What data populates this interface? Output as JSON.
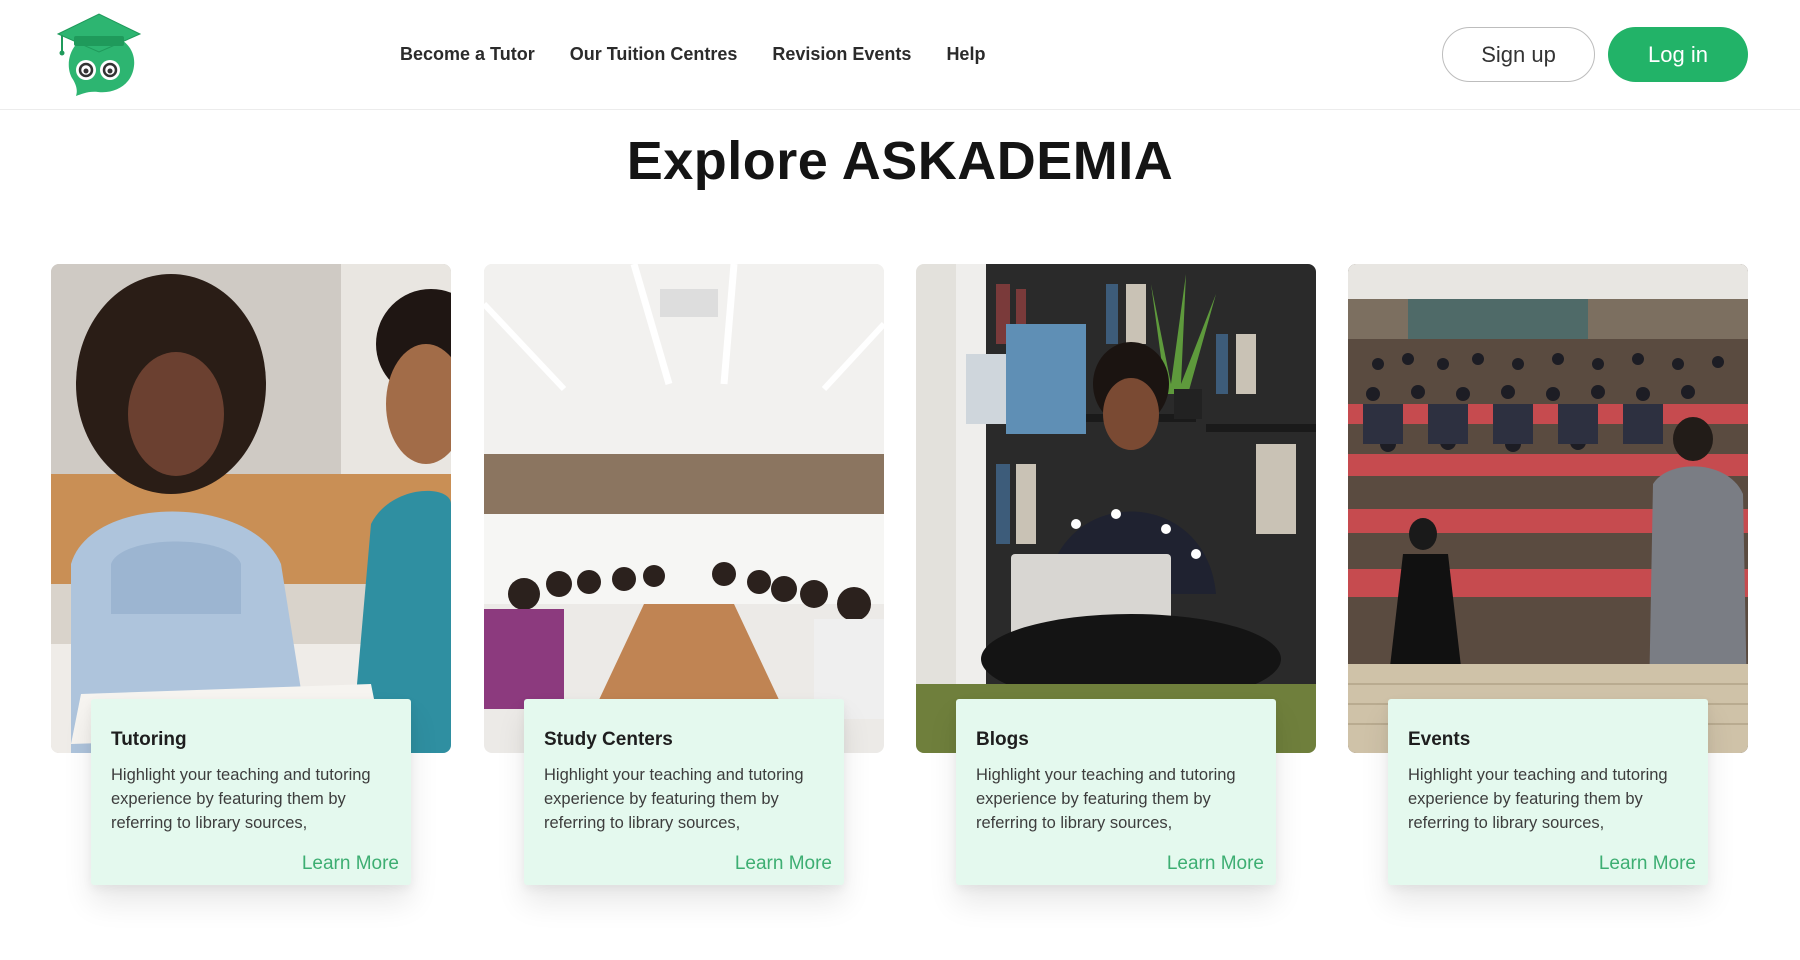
{
  "header": {
    "nav": [
      {
        "label": "Become a Tutor"
      },
      {
        "label": "Our Tuition Centres"
      },
      {
        "label": "Revision Events"
      },
      {
        "label": "Help"
      }
    ],
    "signup_label": "Sign up",
    "login_label": "Log in"
  },
  "main": {
    "title": "Explore ASKADEMIA",
    "cards": [
      {
        "title": "Tutoring",
        "description": "Highlight your teaching and tutoring experience by featuring them by referring to library sources,",
        "link": "Learn More",
        "image": "photo-tutoring"
      },
      {
        "title": "Study Centers",
        "description": "Highlight your teaching and tutoring experience by featuring them by referring to library sources,",
        "link": "Learn More",
        "image": "photo-study-center-meeting"
      },
      {
        "title": "Blogs",
        "description": "Highlight your teaching and tutoring experience by featuring them by referring to library sources,",
        "link": "Learn More",
        "image": "photo-woman-with-laptop"
      },
      {
        "title": "Events",
        "description": "Highlight your teaching and tutoring experience by featuring them by referring to library sources,",
        "link": "Learn More",
        "image": "photo-lecture-hall"
      }
    ]
  },
  "colors": {
    "brand_green": "#22b368",
    "card_bg": "#e4f9ee",
    "link_green": "#3dae72"
  }
}
